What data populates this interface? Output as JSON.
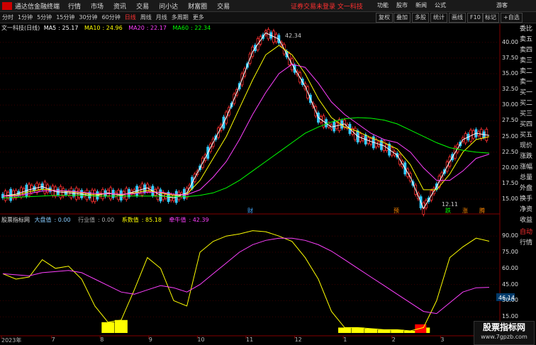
{
  "menubar": {
    "app_name": "通达信金融终端",
    "items": [
      "行情",
      "市场",
      "资讯",
      "交易",
      "问小达",
      "财富圈",
      "交易"
    ],
    "alert": "证券交易未登录",
    "stock_name": "文一科技",
    "right_items": [
      "功能",
      "股市",
      "新闻",
      "公式",
      "游客"
    ]
  },
  "toolbar": {
    "periods": [
      "分时",
      "1分钟",
      "5分钟",
      "15分钟",
      "30分钟",
      "60分钟",
      "日线",
      "周线",
      "月线",
      "多周期",
      "更多"
    ],
    "active_period": "日线",
    "buttons": [
      "复权",
      "叠加",
      "多股",
      "统计",
      "画线",
      "F10",
      "标记",
      "+自选"
    ]
  },
  "main_chart": {
    "title": "文一科技(日线)",
    "ma": [
      {
        "name": "MA5",
        "value": "25.17",
        "color": "#ffffff"
      },
      {
        "name": "MA10",
        "value": "24.96",
        "color": "#ffff00"
      },
      {
        "name": "MA20",
        "value": "22.17",
        "color": "#ff40ff"
      },
      {
        "name": "MA60",
        "value": "22.34",
        "color": "#00ff00"
      }
    ],
    "high_label": "42.34",
    "low_label": "12.11",
    "event_tags": [
      "财",
      "预",
      "跌",
      "涨",
      "腾"
    ]
  },
  "sub_chart": {
    "title": "股票指标网",
    "labels": [
      {
        "name": "大盘值",
        "value": "0.00",
        "color": "#ffffff"
      },
      {
        "name": "行业值",
        "value": "0.00",
        "color": "#aaaaaa"
      },
      {
        "name": "系数值",
        "value": "85.18",
        "color": "#ffff00"
      },
      {
        "name": "牵牛值",
        "value": "42.39",
        "color": "#ff40ff"
      }
    ],
    "current_value": "46.14"
  },
  "right_panel": [
    "委比",
    "卖五",
    "卖四",
    "卖三",
    "卖二",
    "卖一",
    "买一",
    "买二",
    "买三",
    "买四",
    "买五",
    "现价",
    "涨跌",
    "涨幅",
    "总量",
    "外盘",
    "换手",
    "净资",
    "收益",
    "自动",
    "行情"
  ],
  "chart_data": [
    {
      "type": "line",
      "title": "文一科技(日线)",
      "x_ticks": [
        "2023年",
        "7",
        "8",
        "9",
        "10",
        "11",
        "12",
        "1",
        "2",
        "3"
      ],
      "y_ticks": [
        15.0,
        17.5,
        20.0,
        22.5,
        25.0,
        27.5,
        30.0,
        32.5,
        35.0,
        37.5,
        40.0
      ],
      "ylim": [
        14,
        42
      ],
      "series": [
        {
          "name": "MA5",
          "color": "#ffffff",
          "values": [
            15.5,
            15.8,
            16.5,
            17.0,
            16.2,
            16.0,
            15.8,
            15.5,
            16.0,
            15.6,
            16.2,
            16.8,
            15.6,
            15.2,
            16.0,
            20.0,
            24.0,
            28.0,
            33.0,
            38.5,
            41.5,
            40.5,
            36.5,
            33.0,
            28.0,
            26.5,
            27.0,
            25.0,
            24.2,
            23.5,
            22.0,
            18.5,
            13.5,
            17.0,
            21.0,
            24.5,
            25.5,
            25.17
          ]
        },
        {
          "name": "MA10",
          "color": "#ffff00",
          "values": [
            15.5,
            15.6,
            16.2,
            16.6,
            16.4,
            16.2,
            16.0,
            15.7,
            15.9,
            15.7,
            16.0,
            16.4,
            16.0,
            15.6,
            15.8,
            18.0,
            21.5,
            25.0,
            29.5,
            34.0,
            38.0,
            39.5,
            38.0,
            35.0,
            31.0,
            28.0,
            26.5,
            25.8,
            24.8,
            24.0,
            23.0,
            20.5,
            16.5,
            16.5,
            19.0,
            22.5,
            24.5,
            24.96
          ]
        },
        {
          "name": "MA20",
          "color": "#ff40ff",
          "values": [
            15.5,
            15.5,
            15.9,
            16.3,
            16.4,
            16.3,
            16.1,
            15.9,
            15.9,
            15.8,
            15.9,
            16.1,
            16.1,
            15.8,
            15.7,
            16.5,
            18.5,
            21.0,
            24.5,
            28.5,
            32.0,
            35.0,
            36.5,
            36.0,
            33.5,
            30.5,
            28.5,
            27.0,
            25.5,
            24.5,
            24.0,
            22.5,
            20.0,
            18.0,
            18.0,
            19.5,
            21.5,
            22.17
          ]
        },
        {
          "name": "MA60",
          "color": "#00ff00",
          "values": [
            15.2,
            15.3,
            15.4,
            15.5,
            15.6,
            15.6,
            15.6,
            15.5,
            15.5,
            15.5,
            15.5,
            15.5,
            15.5,
            15.4,
            15.4,
            15.6,
            16.0,
            16.8,
            18.0,
            19.5,
            21.0,
            22.5,
            24.0,
            25.5,
            26.5,
            27.3,
            27.8,
            28.0,
            27.9,
            27.6,
            27.0,
            26.0,
            25.0,
            24.0,
            23.2,
            22.8,
            22.5,
            22.34
          ]
        }
      ]
    },
    {
      "type": "line",
      "title": "股票指标网",
      "y_ticks": [
        15.0,
        30.0,
        45.0,
        60.0,
        75.0,
        90.0
      ],
      "ylim": [
        0,
        100
      ],
      "series": [
        {
          "name": "系数值",
          "color": "#ffff00",
          "values": [
            55,
            50,
            52,
            68,
            60,
            62,
            50,
            25,
            10,
            12,
            40,
            70,
            60,
            30,
            25,
            75,
            85,
            90,
            92,
            95,
            94,
            90,
            85,
            70,
            50,
            20,
            5,
            5,
            4,
            3,
            3,
            2,
            5,
            30,
            70,
            80,
            88,
            85.18
          ]
        },
        {
          "name": "牵牛值",
          "color": "#ff40ff",
          "values": [
            55,
            54,
            53,
            56,
            57,
            58,
            56,
            50,
            44,
            38,
            36,
            40,
            44,
            42,
            38,
            45,
            55,
            65,
            75,
            82,
            86,
            88,
            88,
            86,
            82,
            76,
            68,
            60,
            52,
            44,
            36,
            28,
            20,
            18,
            28,
            38,
            42,
            42.39
          ]
        }
      ]
    }
  ]
}
